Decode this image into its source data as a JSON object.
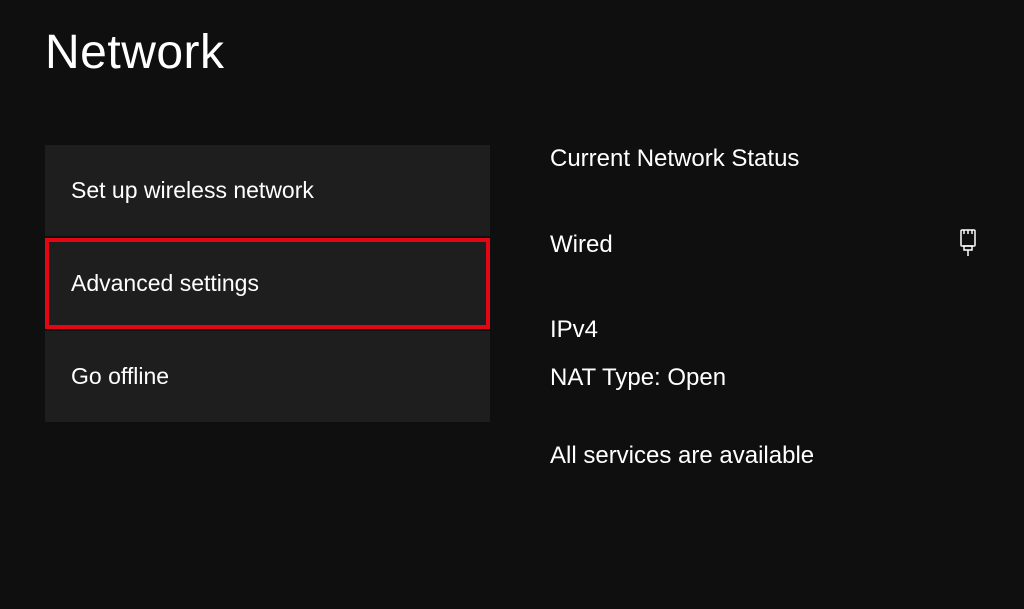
{
  "page": {
    "title": "Network"
  },
  "nav": {
    "items": [
      {
        "label": "Set up wireless network",
        "highlighted": false
      },
      {
        "label": "Advanced settings",
        "highlighted": true
      },
      {
        "label": "Go offline",
        "highlighted": false
      }
    ]
  },
  "status": {
    "heading": "Current Network Status",
    "connection_type": "Wired",
    "ip_version": "IPv4",
    "nat_type": "NAT Type: Open",
    "services": "All services are available"
  }
}
